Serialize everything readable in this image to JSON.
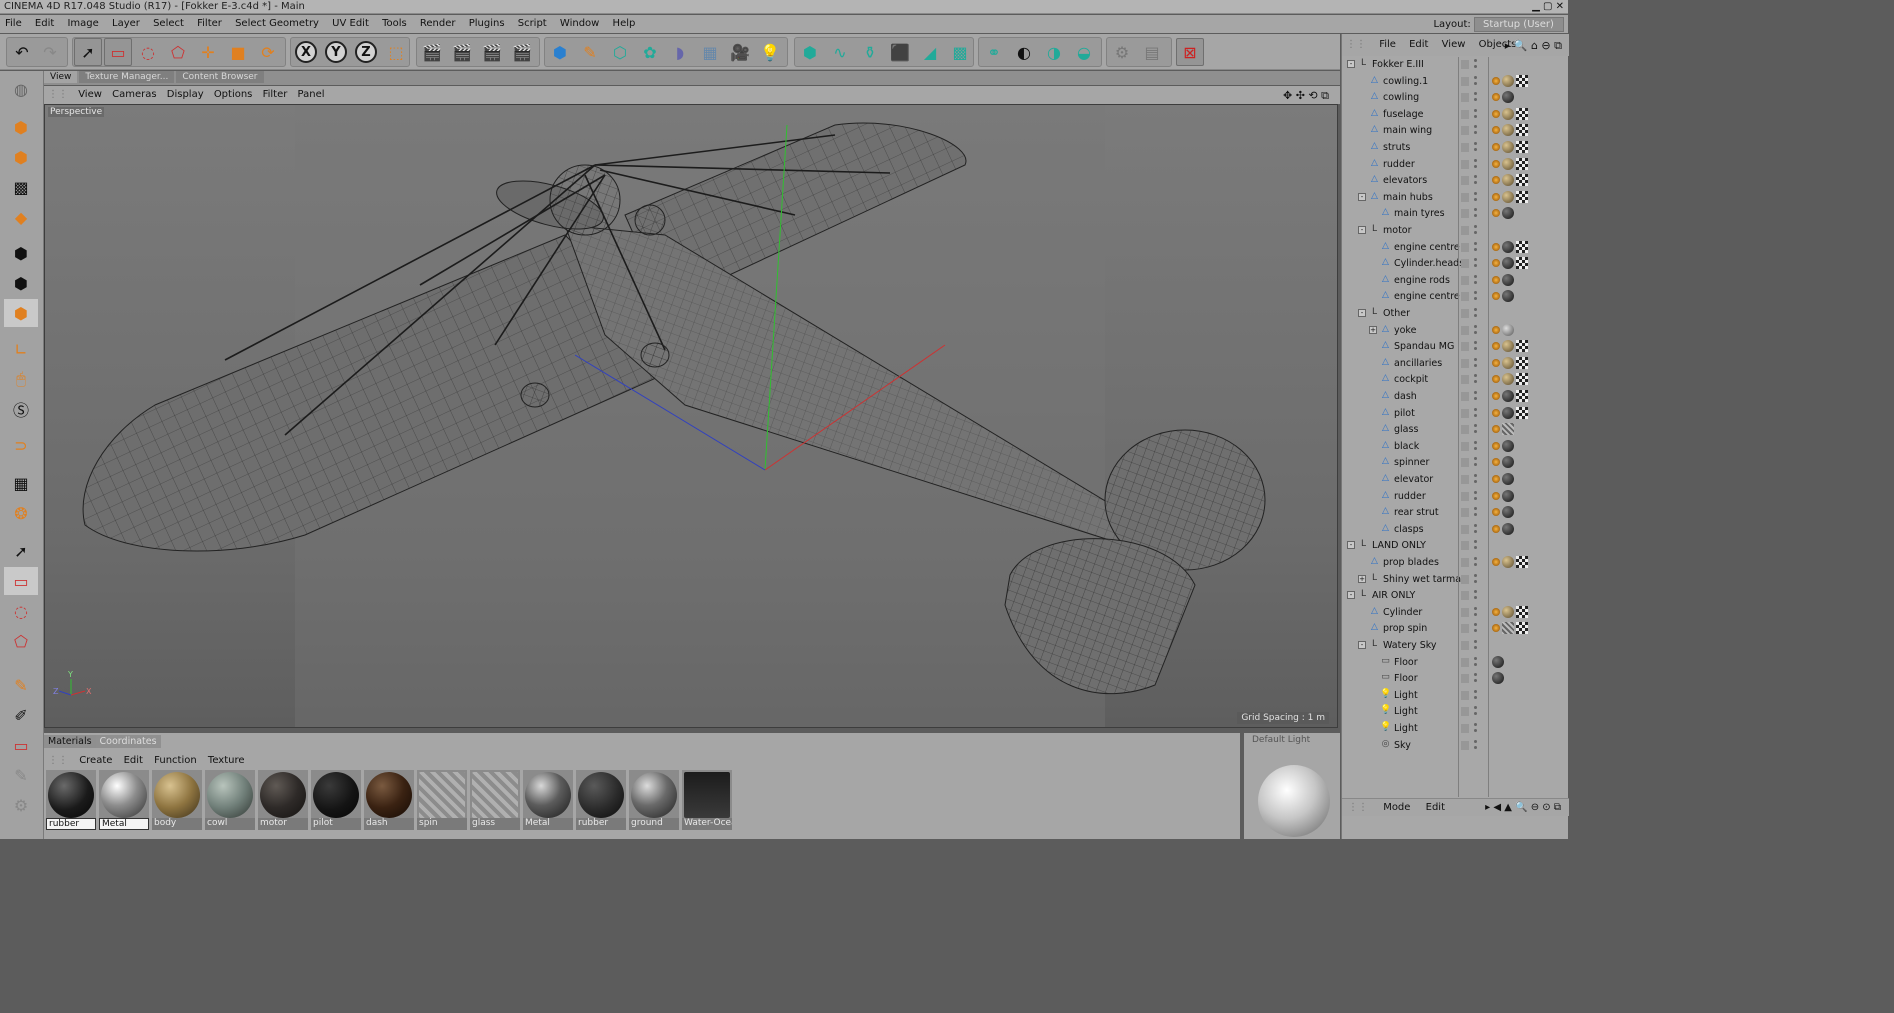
{
  "window": {
    "title": "CINEMA 4D R17.048 Studio (R17) - [Fokker E-3.c4d *] - Main"
  },
  "menu": [
    "File",
    "Edit",
    "Image",
    "Layer",
    "Select",
    "Filter",
    "Select Geometry",
    "UV Edit",
    "Tools",
    "Render",
    "Plugins",
    "Script",
    "Window",
    "Help"
  ],
  "layout": {
    "label": "Layout:",
    "value": "Startup (User)"
  },
  "view_tabs": [
    "View",
    "Texture Manager...",
    "Content Browser"
  ],
  "view_menu": [
    "View",
    "Cameras",
    "Display",
    "Options",
    "Filter",
    "Panel"
  ],
  "viewport": {
    "camera_label": "Perspective",
    "grid_spacing": "Grid Spacing : 1 m",
    "axis_labels": {
      "x": "X",
      "y": "Y",
      "z": "Z"
    }
  },
  "toolbar": {
    "axis_x": "X",
    "axis_y": "Y",
    "axis_z": "Z"
  },
  "materials": {
    "tabs": [
      "Materials",
      "Coordinates"
    ],
    "menu": [
      "Create",
      "Edit",
      "Function",
      "Texture"
    ],
    "items": [
      {
        "name": "rubber",
        "style": "black"
      },
      {
        "name": "Metal",
        "style": "metal"
      },
      {
        "name": "body",
        "style": "body"
      },
      {
        "name": "cowl",
        "style": "cowl"
      },
      {
        "name": "motor",
        "style": "motor"
      },
      {
        "name": "pilot",
        "style": "pilot"
      },
      {
        "name": "dash",
        "style": "dash"
      },
      {
        "name": "spin",
        "style": "spin"
      },
      {
        "name": "glass",
        "style": "glass"
      },
      {
        "name": "Metal",
        "style": "metal2"
      },
      {
        "name": "rubber",
        "style": "rubber2"
      },
      {
        "name": "ground",
        "style": "ground"
      },
      {
        "name": "Water-Ocea",
        "style": "water"
      }
    ],
    "preview_label": "Default Light"
  },
  "object_manager": {
    "menu": [
      "File",
      "Edit",
      "View",
      "Objects"
    ],
    "footer": [
      "Mode",
      "Edit"
    ],
    "objects": [
      {
        "name": "Fokker E.III",
        "depth": 0,
        "type": "null",
        "expander": "-",
        "tags": []
      },
      {
        "name": "cowling.1",
        "depth": 1,
        "type": "poly",
        "tags": [
          "phong",
          "tex",
          "chk"
        ]
      },
      {
        "name": "cowling",
        "depth": 1,
        "type": "poly",
        "tags": [
          "phong",
          "blk"
        ]
      },
      {
        "name": "fuselage",
        "depth": 1,
        "type": "poly",
        "tags": [
          "phong",
          "tex",
          "chk"
        ]
      },
      {
        "name": "main wing",
        "depth": 1,
        "type": "poly",
        "tags": [
          "phong",
          "tex",
          "chk"
        ]
      },
      {
        "name": "struts",
        "depth": 1,
        "type": "poly",
        "tags": [
          "phong",
          "tex",
          "chk"
        ]
      },
      {
        "name": "rudder",
        "depth": 1,
        "type": "poly",
        "tags": [
          "phong",
          "tex",
          "chk"
        ]
      },
      {
        "name": "elevators",
        "depth": 1,
        "type": "poly",
        "tags": [
          "phong",
          "tex",
          "chk"
        ]
      },
      {
        "name": "main hubs",
        "depth": 1,
        "type": "poly",
        "expander": "-",
        "tags": [
          "phong",
          "tex",
          "chk"
        ]
      },
      {
        "name": "main tyres",
        "depth": 2,
        "type": "poly",
        "tags": [
          "phong",
          "blk"
        ]
      },
      {
        "name": "motor",
        "depth": 1,
        "type": "null",
        "expander": "-",
        "tags": []
      },
      {
        "name": "engine centre",
        "depth": 2,
        "type": "poly",
        "tags": [
          "phong",
          "blk",
          "chk"
        ]
      },
      {
        "name": "Cylinder.heads",
        "depth": 2,
        "type": "poly",
        "tags": [
          "phong",
          "blk",
          "chk"
        ]
      },
      {
        "name": "engine rods",
        "depth": 2,
        "type": "poly",
        "tags": [
          "phong",
          "blk"
        ]
      },
      {
        "name": "engine centre",
        "depth": 2,
        "type": "poly",
        "tags": [
          "phong",
          "blk"
        ]
      },
      {
        "name": "Other",
        "depth": 1,
        "type": "null",
        "expander": "-",
        "tags": []
      },
      {
        "name": "yoke",
        "depth": 2,
        "type": "poly",
        "expander": "+",
        "tags": [
          "phong",
          "gry"
        ]
      },
      {
        "name": "Spandau MG",
        "depth": 2,
        "type": "poly",
        "tags": [
          "phong",
          "tex",
          "chk"
        ]
      },
      {
        "name": "ancillaries",
        "depth": 2,
        "type": "poly",
        "tags": [
          "phong",
          "tex",
          "chk"
        ]
      },
      {
        "name": "cockpit",
        "depth": 2,
        "type": "poly",
        "tags": [
          "phong",
          "tex",
          "chk"
        ]
      },
      {
        "name": "dash",
        "depth": 2,
        "type": "poly",
        "tags": [
          "phong",
          "blk",
          "chk"
        ]
      },
      {
        "name": "pilot",
        "depth": 2,
        "type": "poly",
        "tags": [
          "phong",
          "blk",
          "chk"
        ]
      },
      {
        "name": "glass",
        "depth": 2,
        "type": "poly",
        "tags": [
          "phong",
          "stripe"
        ]
      },
      {
        "name": "black",
        "depth": 2,
        "type": "poly",
        "tags": [
          "phong",
          "blk"
        ]
      },
      {
        "name": "spinner",
        "depth": 2,
        "type": "poly",
        "tags": [
          "phong",
          "blk"
        ]
      },
      {
        "name": "elevator",
        "depth": 2,
        "type": "poly",
        "tags": [
          "phong",
          "blk"
        ]
      },
      {
        "name": "rudder",
        "depth": 2,
        "type": "poly",
        "tags": [
          "phong",
          "blk"
        ]
      },
      {
        "name": "rear strut",
        "depth": 2,
        "type": "poly",
        "tags": [
          "phong",
          "blk"
        ]
      },
      {
        "name": "clasps",
        "depth": 2,
        "type": "poly",
        "tags": [
          "phong",
          "blk"
        ]
      },
      {
        "name": "LAND ONLY",
        "depth": 0,
        "type": "null",
        "expander": "-",
        "tags": []
      },
      {
        "name": "prop blades",
        "depth": 1,
        "type": "poly",
        "tags": [
          "phong",
          "tex",
          "chk"
        ]
      },
      {
        "name": "Shiny wet  tarmac",
        "depth": 1,
        "type": "null",
        "expander": "+",
        "tags": []
      },
      {
        "name": "AIR ONLY",
        "depth": 0,
        "type": "null",
        "expander": "-",
        "tags": []
      },
      {
        "name": "Cylinder",
        "depth": 1,
        "type": "poly",
        "tags": [
          "phong",
          "tex",
          "chk"
        ]
      },
      {
        "name": "prop spin",
        "depth": 1,
        "type": "poly",
        "tags": [
          "phong",
          "stripe",
          "chk"
        ]
      },
      {
        "name": "Watery Sky",
        "depth": 1,
        "type": "null",
        "expander": "-",
        "tags": []
      },
      {
        "name": "Floor",
        "depth": 2,
        "type": "floor",
        "tags": [
          "blk"
        ]
      },
      {
        "name": "Floor",
        "depth": 2,
        "type": "floor",
        "tags": [
          "blk"
        ]
      },
      {
        "name": "Light",
        "depth": 2,
        "type": "light",
        "tags": []
      },
      {
        "name": "Light",
        "depth": 2,
        "type": "light",
        "tags": []
      },
      {
        "name": "Light",
        "depth": 2,
        "type": "light",
        "tags": []
      },
      {
        "name": "Sky",
        "depth": 2,
        "type": "sky",
        "tags": []
      }
    ]
  },
  "colors": {
    "ui_bg": "#a6a6a6",
    "viewport_bg": "#6e6e6e",
    "axis_x": "#d03030",
    "axis_y": "#30c030",
    "axis_z": "#3040c0",
    "accent_orange": "#e08020"
  }
}
